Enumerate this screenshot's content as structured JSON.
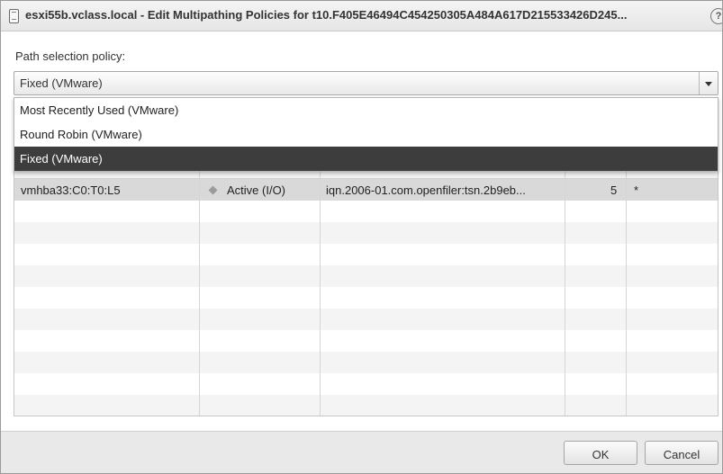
{
  "window": {
    "title": "esxi55b.vclass.local - Edit Multipathing Policies for t10.F405E46494C454250305A484A617D215533426D245...",
    "help_glyph": "?"
  },
  "policy": {
    "label": "Path selection policy:",
    "selected": "Fixed (VMware)",
    "options": [
      {
        "label": "Most Recently Used (VMware)",
        "selected": false
      },
      {
        "label": "Round Robin (VMware)",
        "selected": false
      },
      {
        "label": "Fixed (VMware)",
        "selected": true
      }
    ]
  },
  "paths_table": {
    "rows": [
      {
        "runtime_name": "vmhba33:C0:T0:L5",
        "status_icon": "diamond-icon",
        "status": "Active (I/O)",
        "target": "iqn.2006-01.com.openfiler:tsn.2b9eb...",
        "lun": "5",
        "preferred": "*"
      }
    ]
  },
  "footer": {
    "ok_label": "OK",
    "cancel_label": "Cancel"
  },
  "colors": {
    "dropdown_selected_bg": "#3d3d3d",
    "row_selected_bg": "#d9d9d9"
  }
}
